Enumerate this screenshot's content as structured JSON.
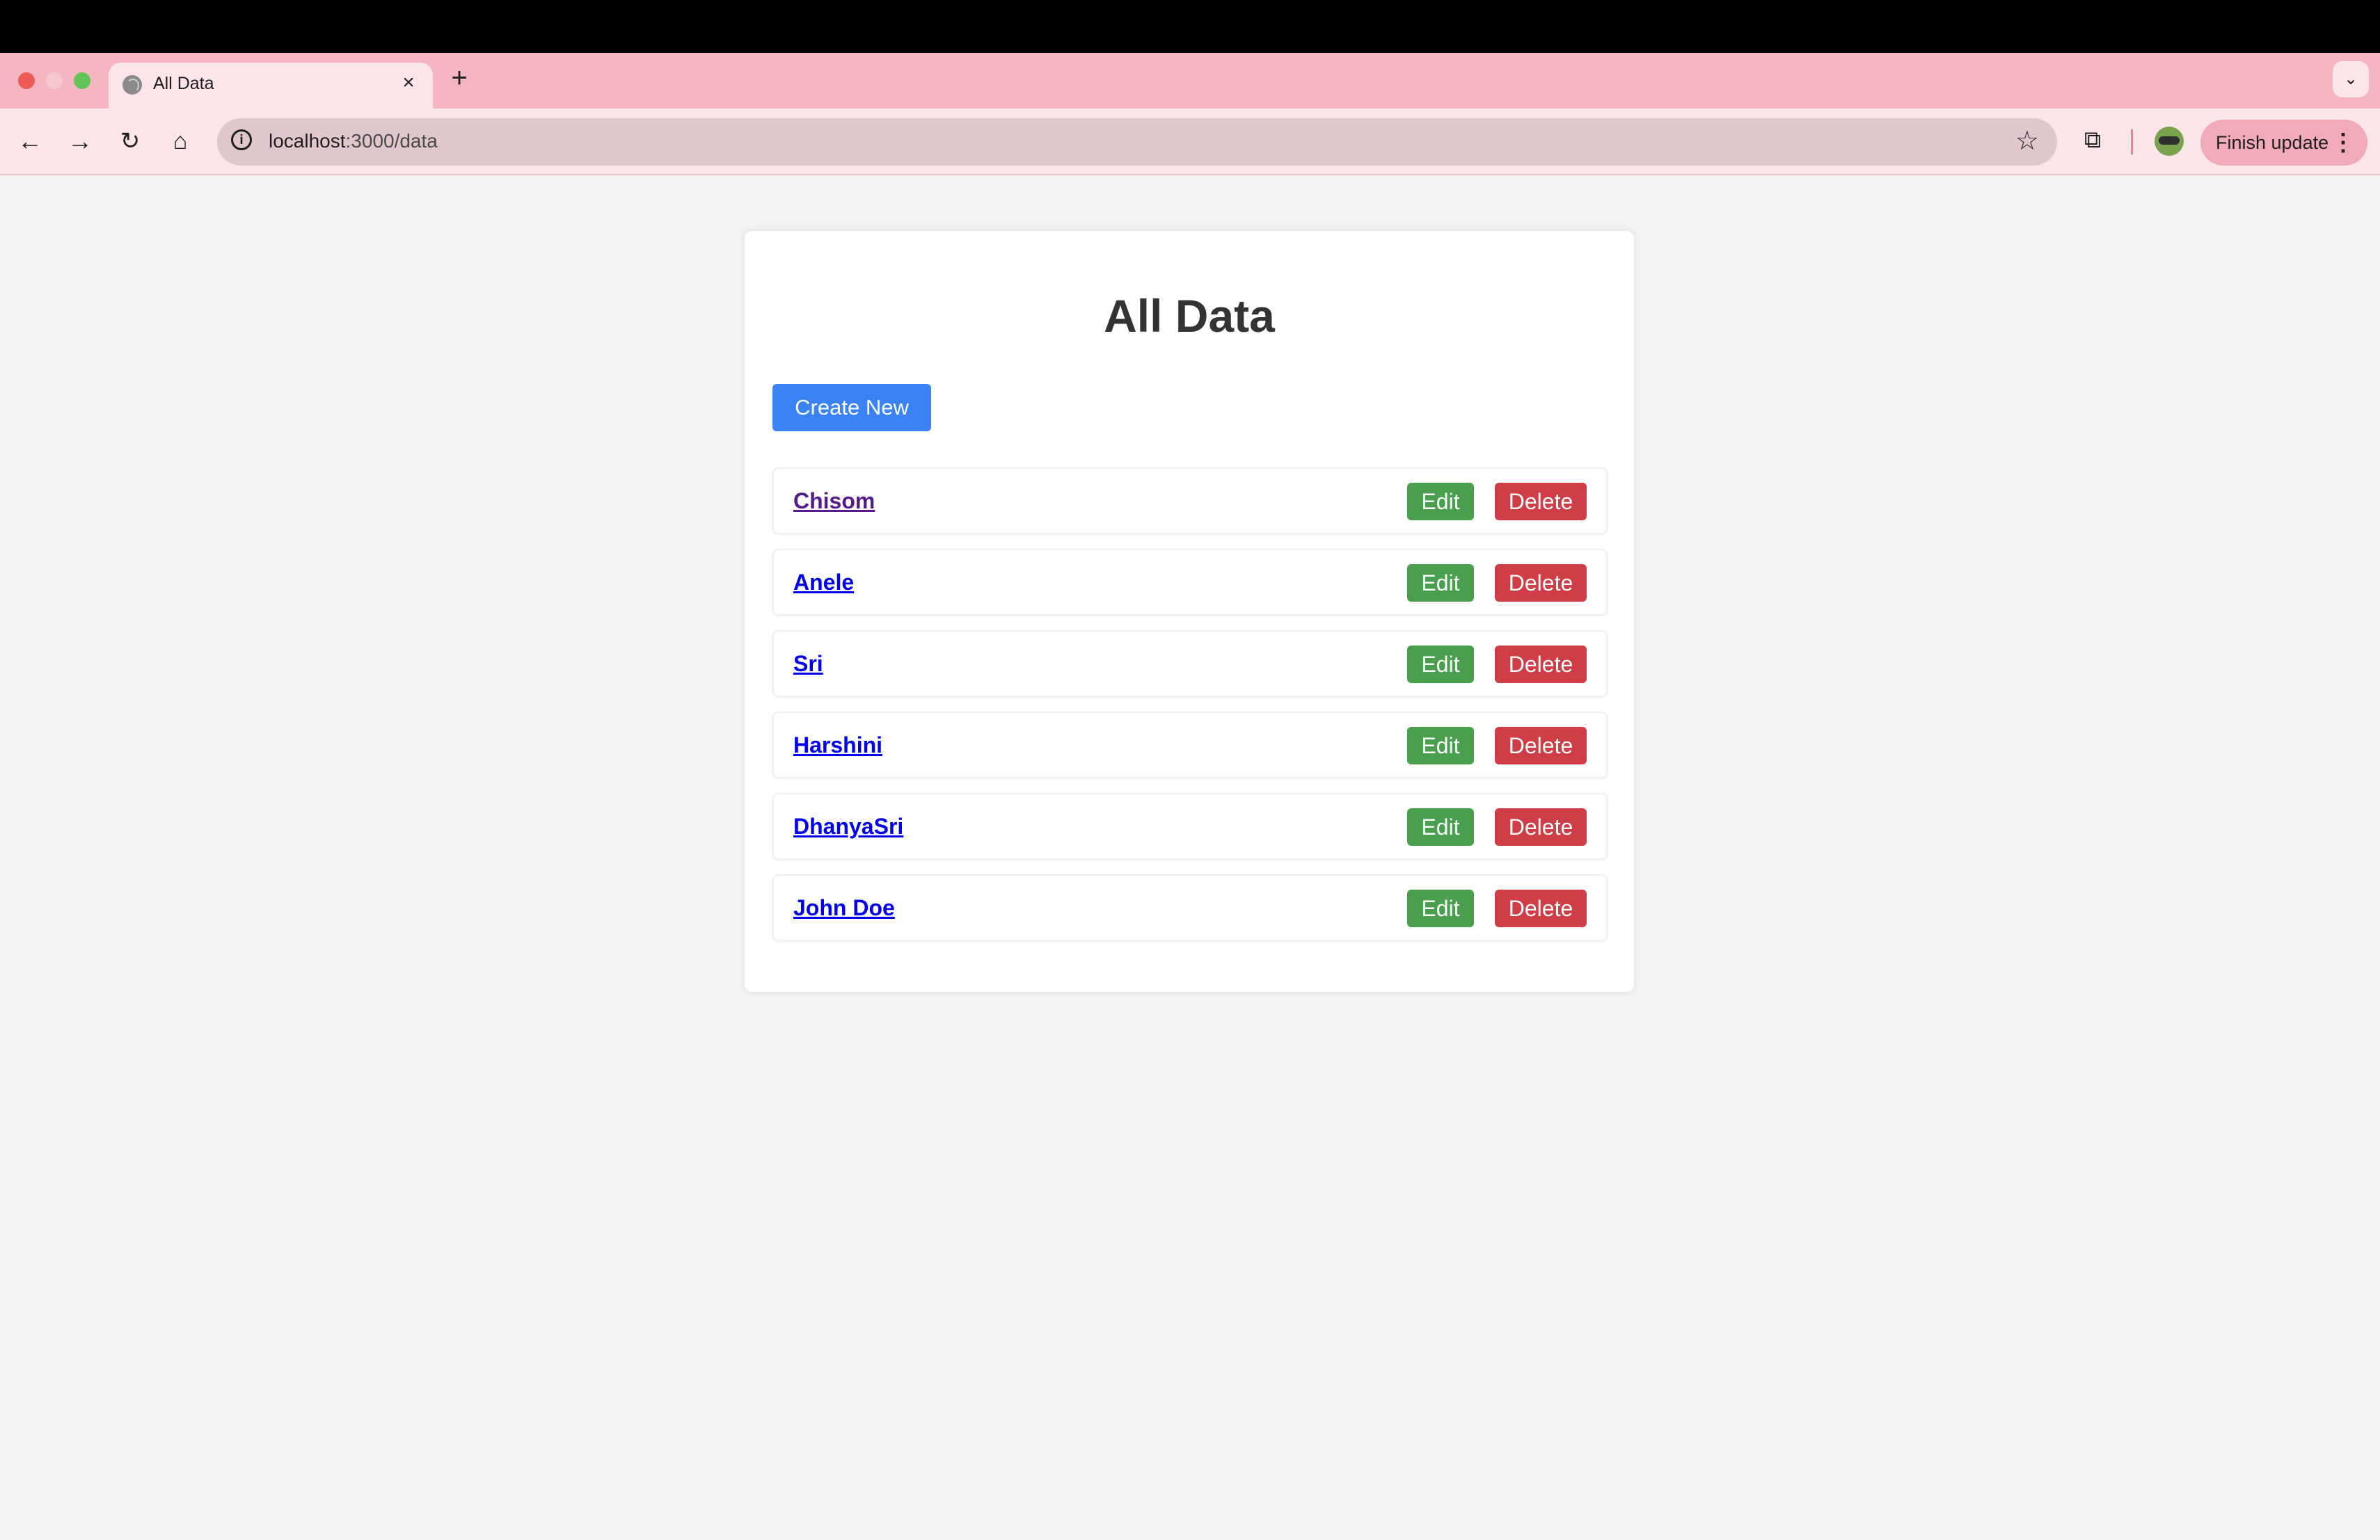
{
  "browser": {
    "tab": {
      "title": "All Data",
      "close_icon": "close-icon",
      "favicon": "globe-icon"
    },
    "new_tab_icon": "plus-icon",
    "tab_dropdown_icon": "chevron-down-icon",
    "address": {
      "url_host": "localhost",
      "url_path": ":3000/data"
    },
    "finish_update_label": "Finish update",
    "colors": {
      "tabbar": "#f5b5c1",
      "toolbar": "#fbe5e9",
      "address_bar": "#e0c7cb",
      "finish_button": "#f0aab8"
    }
  },
  "page": {
    "title": "All Data",
    "create_button_label": "Create New",
    "items": [
      {
        "name": "Chisom",
        "visited": true
      },
      {
        "name": "Anele",
        "visited": false
      },
      {
        "name": "Sri",
        "visited": false
      },
      {
        "name": "Harshini",
        "visited": false
      },
      {
        "name": "DhanyaSri",
        "visited": false
      },
      {
        "name": "John Doe",
        "visited": false
      }
    ],
    "edit_label": "Edit",
    "delete_label": "Delete",
    "colors": {
      "create": "#3b82f6",
      "edit": "#4a9f4e",
      "delete": "#cf3e47",
      "link": "#0000ee",
      "link_visited": "#551a8b"
    }
  }
}
